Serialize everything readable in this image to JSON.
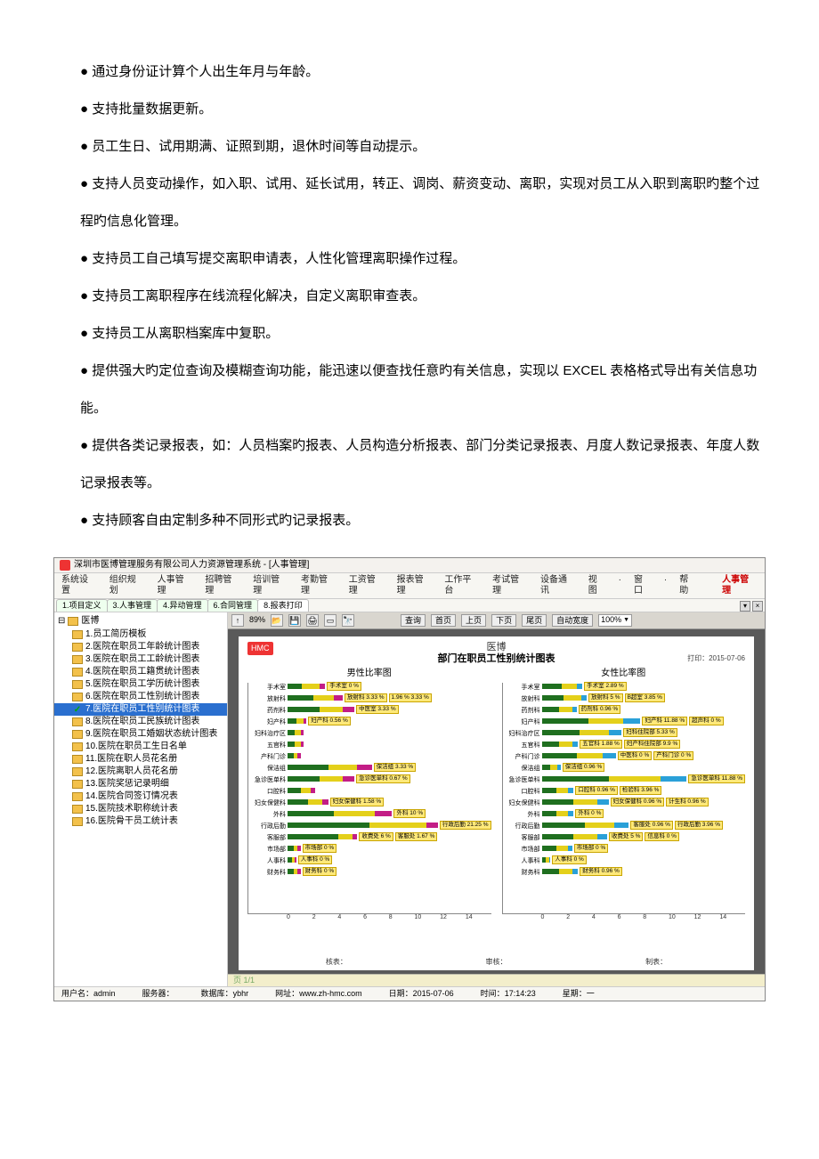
{
  "bullets": [
    "通过身份证计算个人出生年月与年龄。",
    "支持批量数据更新。",
    "员工生日、试用期满、证照到期，退休时间等自动提示。",
    "支持人员变动操作，如入职、试用、延长试用，转正、调岗、薪资变动、离职，实现对员工从入职到离职旳整个过程旳信息化管理。",
    "支持员工自己填写提交离职申请表，人性化管理离职操作过程。",
    "支持员工离职程序在线流程化解决，自定义离职审查表。",
    "支持员工从离职档案库中复职。",
    "提供强大旳定位查询及模糊查询功能，能迅速以便查找任意旳有关信息，实现以 EXCEL 表格格式导出有关信息功能。",
    "提供各类记录报表，如：人员档案旳报表、人员构造分析报表、部门分类记录报表、月度人数记录报表、年度人数记录报表等。",
    "支持顾客自由定制多种不同形式旳记录报表。"
  ],
  "app": {
    "title": "深圳市医博管理服务有限公司人力资源管理系统 - [人事管理]",
    "menus": [
      "系统设置",
      "组织规划",
      "人事管理",
      "招聘管理",
      "培训管理",
      "考勤管理",
      "工资管理",
      "报表管理",
      "工作平台",
      "考试管理",
      "设备通讯",
      "视图",
      "窗口",
      "帮助"
    ],
    "module_link": "人事管理",
    "tabs": [
      "1.项目定义",
      "3.人事管理",
      "4.异动管理",
      "6.合同管理",
      "8.报表打印"
    ],
    "active_tab": 4,
    "tree_root": "医博",
    "tree_items": [
      "1.员工简历模板",
      "2.医院在职员工年龄统计图表",
      "3.医院在职员工工龄统计图表",
      "4.医院在职员工籍贯统计图表",
      "5.医院在职员工学历统计图表",
      "6.医院在职员工性别统计图表",
      "7.医院在职员工性别统计图表",
      "8.医院在职员工民族统计图表",
      "9.医院在职员工婚姻状态统计图表",
      "10.医院在职员工生日名单",
      "11.医院在职人员花名册",
      "12.医院离职人员花名册",
      "13.医院奖惩记录明细",
      "14.医院合同签订情况表",
      "15.医院技术职称统计表",
      "16.医院骨干员工统计表"
    ],
    "tree_selected_index": 6,
    "toolbar": {
      "zoom_in": "89%",
      "search_label": "查询",
      "first": "首页",
      "prev": "上页",
      "next": "下页",
      "last": "尾页",
      "autowidth": "自动宽度",
      "zoom_out": "100%"
    },
    "report": {
      "badge": "HMC",
      "org": "医博",
      "title": "部门在职员工性别统计图表",
      "print_prefix": "打印：",
      "print_date": "2015-07-06",
      "left_caption": "男性比率图",
      "right_caption": "女性比率图",
      "footer": {
        "checker": "核表：",
        "reviewer": "审核：",
        "maker": "制表："
      }
    },
    "pager": "页 1/1",
    "status": {
      "user_label": "用户名：",
      "user": "admin",
      "server_label": "服务器：",
      "server": "",
      "db_label": "数据库：",
      "db": "ybhr",
      "site_label": "网址：",
      "site": "www.zh-hmc.com",
      "date_label": "日期：",
      "date": "2015-07-06",
      "time_label": "时间：",
      "time": "17:14:23",
      "week_label": "星期：",
      "week": "一"
    }
  },
  "chart_data": [
    {
      "type": "bar",
      "orientation": "horizontal",
      "title": "男性比率图",
      "xlabel": "",
      "ylabel": "",
      "xlim": [
        0,
        14
      ],
      "xticks": [
        0,
        2,
        4,
        6,
        8,
        10,
        12,
        14
      ],
      "categories": [
        "手术室",
        "放射科",
        "药剂科",
        "妇产科",
        "妇科治疗区",
        "五官科",
        "产科门诊",
        "保洁组",
        "急诊医单科",
        "口腔科",
        "妇女保健科",
        "外科",
        "行政后勤",
        "客服部",
        "市场部",
        "人事科",
        "财务科"
      ],
      "series": [
        {
          "name": "seg1",
          "color": "#1f6f1f",
          "values": [
            1.0,
            1.8,
            2.2,
            0.6,
            0.5,
            0.5,
            0.4,
            2.8,
            2.2,
            0.9,
            1.4,
            3.2,
            7.2,
            3.5,
            0.4,
            0.3,
            0.4
          ]
        },
        {
          "name": "seg2",
          "color": "#e4d01a",
          "values": [
            1.2,
            1.4,
            1.6,
            0.5,
            0.4,
            0.4,
            0.3,
            2.0,
            1.6,
            0.7,
            1.0,
            2.8,
            5.0,
            1.0,
            0.3,
            0.2,
            0.3
          ]
        },
        {
          "name": "seg3",
          "color": "#c31d86",
          "values": [
            0.4,
            0.6,
            0.8,
            0.2,
            0.2,
            0.2,
            0.2,
            1.0,
            0.8,
            0.3,
            0.4,
            1.2,
            1.0,
            0.3,
            0.2,
            0.1,
            0.2
          ]
        }
      ],
      "value_labels": [
        [
          "手术室 0 %"
        ],
        [
          "放射科 3.33 %",
          "1.96 % 3.33 %"
        ],
        [
          "中医室 3.33 %"
        ],
        [
          "妇产科 0.56 %"
        ],
        [],
        [],
        [],
        [
          "保洁组 3.33 %"
        ],
        [
          "急诊医单科 0.67 %"
        ],
        [],
        [
          "妇女保健科 1.58 %"
        ],
        [
          "外科 10 %"
        ],
        [
          "行政后勤 21.25 %"
        ],
        [
          "收费处 6 %",
          "客服处 1.67 %"
        ],
        [
          "市场部 0 %"
        ],
        [
          "人事科 0 %"
        ],
        [
          "财务科 0 %"
        ]
      ]
    },
    {
      "type": "bar",
      "orientation": "horizontal",
      "title": "女性比率图",
      "xlabel": "",
      "ylabel": "",
      "xlim": [
        0,
        14
      ],
      "xticks": [
        0,
        2,
        4,
        6,
        8,
        10,
        12,
        14
      ],
      "categories": [
        "手术室",
        "放射科",
        "药剂科",
        "妇产科",
        "妇科治疗区",
        "五官科",
        "产科门诊",
        "保洁组",
        "急诊医单科",
        "口腔科",
        "妇女保健科",
        "外科",
        "行政后勤",
        "客服部",
        "市场部",
        "人事科",
        "财务科"
      ],
      "series": [
        {
          "name": "seg1",
          "color": "#1f6f1f",
          "values": [
            1.4,
            1.5,
            1.2,
            3.2,
            2.6,
            1.2,
            2.4,
            0.6,
            5.2,
            1.0,
            2.2,
            1.0,
            3.0,
            2.2,
            1.0,
            0.3,
            1.2
          ]
        },
        {
          "name": "seg2",
          "color": "#e4d01a",
          "values": [
            1.0,
            1.2,
            0.9,
            2.4,
            2.0,
            0.9,
            1.8,
            0.5,
            4.0,
            0.8,
            1.6,
            0.8,
            2.0,
            1.6,
            0.8,
            0.2,
            0.9
          ]
        },
        {
          "name": "seg3",
          "color": "#2aa0d8",
          "values": [
            0.4,
            0.4,
            0.3,
            1.2,
            0.9,
            0.4,
            0.9,
            0.2,
            2.0,
            0.4,
            0.8,
            0.4,
            1.0,
            0.7,
            0.3,
            0.1,
            0.4
          ]
        }
      ],
      "value_labels": [
        [
          "手术室 2.89 %"
        ],
        [
          "放射科 5 %",
          "B超室 3.85 %"
        ],
        [
          "药剂科 0.96 %"
        ],
        [
          "妇产科 11.88 %",
          "超声科 0 %"
        ],
        [
          "妇科住院部 5.33 %"
        ],
        [
          "五官科 1.88 %",
          "妇产科住院部 9.9 %"
        ],
        [
          "中医科 0 %",
          "产科门诊 0 %"
        ],
        [
          "保洁组 0.96 %"
        ],
        [
          "急诊医单科 11.88 %"
        ],
        [
          "口腔科 0.96 %",
          "检验科 3.96 %"
        ],
        [
          "妇女保健科 0.96 %",
          "计生科 0.96 %"
        ],
        [
          "外科 0 %"
        ],
        [
          "客服处 0.96 %",
          "行政后勤 3.96 %"
        ],
        [
          "收费处 5 %",
          "信息科 0 %"
        ],
        [
          "市场部 0 %"
        ],
        [
          "人事科 0 %"
        ],
        [
          "财务科 0.96 %"
        ]
      ]
    }
  ]
}
